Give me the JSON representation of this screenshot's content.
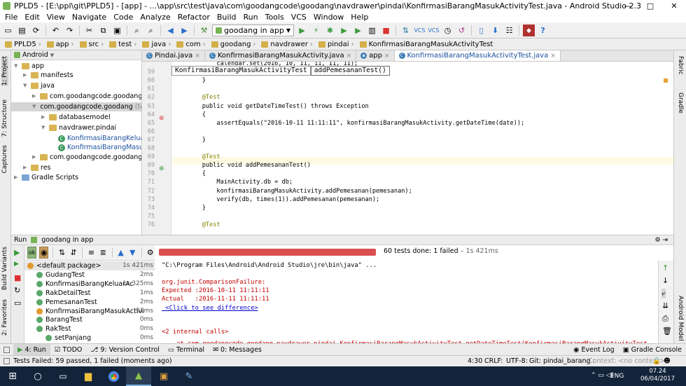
{
  "window": {
    "title": "PPLD5 - [E:\\ppl\\git\\PPLD5] - [app] - ...\\app\\src\\test\\java\\com\\goodangcode\\goodang\\navdrawer\\pindai\\KonfirmasiBarangMasukActivityTest.java - Android Studio 2.3"
  },
  "menu": [
    "File",
    "Edit",
    "View",
    "Navigate",
    "Code",
    "Analyze",
    "Refactor",
    "Build",
    "Run",
    "Tools",
    "VCS",
    "Window",
    "Help"
  ],
  "toolbar": {
    "run_config": "goodang in app"
  },
  "breadcrumbs": [
    "PPLD5",
    "app",
    "src",
    "test",
    "java",
    "com",
    "goodang",
    "navdrawer",
    "pindai",
    "KonfirmasiBarangMasukActivityTest"
  ],
  "project": {
    "view_mode": "Android",
    "tree": [
      {
        "label": "app",
        "indent": 0,
        "kind": "folder"
      },
      {
        "label": "manifests",
        "indent": 1,
        "kind": "folder"
      },
      {
        "label": "java",
        "indent": 1,
        "kind": "folder"
      },
      {
        "label": "com.goodangcode.goodang",
        "indent": 2,
        "kind": "package"
      },
      {
        "label": "com.goodangcode.goodang",
        "suffix": "(test)",
        "indent": 2,
        "kind": "package",
        "selected": true
      },
      {
        "label": "databasemodel",
        "indent": 3,
        "kind": "folder"
      },
      {
        "label": "navdrawer.pindai",
        "indent": 3,
        "kind": "folder"
      },
      {
        "label": "KonfirmasiBarangKeluar",
        "indent": 4,
        "kind": "class"
      },
      {
        "label": "KonfirmasiBarangMasuk",
        "indent": 4,
        "kind": "class"
      },
      {
        "label": "com.goodangcode.goodang.datab",
        "indent": 2,
        "kind": "package"
      },
      {
        "label": "res",
        "indent": 1,
        "kind": "folder"
      },
      {
        "label": "Gradle Scripts",
        "indent": 0,
        "kind": "gradle"
      }
    ]
  },
  "tabs": [
    {
      "label": "Pindai.java",
      "active": false
    },
    {
      "label": "KonfirmasiBarangMasukActivity.java",
      "active": false
    },
    {
      "label": "app",
      "active": false
    },
    {
      "label": "KonfirmasiBarangMasukActivityTest.java",
      "active": true
    }
  ],
  "editor": {
    "popup": [
      "KonfirmasiBarangMasukActivityTest",
      "addPemesananTest()"
    ],
    "lines": [
      {
        "n": "",
        "text": "        calendar.set(2016, 10, 11, 11, 11, 11);"
      },
      {
        "n": "59",
        "text": "        date = calendar.getTime();"
      },
      {
        "n": "60",
        "text": "    }"
      },
      {
        "n": "61",
        "text": ""
      },
      {
        "n": "62",
        "text": "    @Test"
      },
      {
        "n": "63",
        "text": "    public void getDateTimeTest() throws Exception"
      },
      {
        "n": "64",
        "text": "    {"
      },
      {
        "n": "65",
        "text": "        assertEquals(\"2016-10-11 11:11:11\", konfirmasiBarangMasukActivity.getDateTime(date));"
      },
      {
        "n": "66",
        "text": ""
      },
      {
        "n": "67",
        "text": "    }"
      },
      {
        "n": "68",
        "text": ""
      },
      {
        "n": "69",
        "text": "    @Test"
      },
      {
        "n": "69",
        "text": "    public void addPemesananTest()"
      },
      {
        "n": "70",
        "text": "    {"
      },
      {
        "n": "71",
        "text": "        MainActivity.db = db;"
      },
      {
        "n": "72",
        "text": "        konfirmasiBarangMasukActivity.addPemesanan(pemesanan);"
      },
      {
        "n": "73",
        "text": "        verify(db, times(1)).addPemesanan(pemesanan);"
      },
      {
        "n": "74",
        "text": "    }"
      },
      {
        "n": "75",
        "text": ""
      },
      {
        "n": "76",
        "text": "    @Test"
      }
    ]
  },
  "run": {
    "header_label": "Run",
    "config": "goodang in app",
    "status": "60 tests done: 1 failed",
    "duration": "– 1s 421ms",
    "tests": [
      {
        "name": "<default package>",
        "time": "1s 421ms",
        "status": "fail",
        "indent": 0
      },
      {
        "name": "GudangTest",
        "time": "2ms",
        "status": "ok",
        "indent": 1
      },
      {
        "name": "KonfirmasiBarangKeluarAc",
        "time": "1s 325ms",
        "status": "ok",
        "indent": 1
      },
      {
        "name": "RakDetailTest",
        "time": "1ms",
        "status": "ok",
        "indent": 1
      },
      {
        "name": "PemesananTest",
        "time": "2ms",
        "status": "ok",
        "indent": 1
      },
      {
        "name": "KonfirmasiBarangMasukActivi",
        "time": "91ms",
        "status": "fail",
        "indent": 1
      },
      {
        "name": "BarangTest",
        "time": "0ms",
        "status": "ok",
        "indent": 1
      },
      {
        "name": "RakTest",
        "time": "0ms",
        "status": "ok",
        "indent": 1
      },
      {
        "name": "setPanjang",
        "time": "0ms",
        "status": "ok",
        "indent": 2
      }
    ],
    "console": [
      {
        "text": "\"C:\\Program Files\\Android\\Android Studio\\jre\\bin\\java\" ...",
        "cls": ""
      },
      {
        "text": "",
        "cls": ""
      },
      {
        "text": "org.junit.ComparisonFailure:",
        "cls": "red"
      },
      {
        "text": "Expected :2016-10-11 11:11:11",
        "cls": "red"
      },
      {
        "text": "Actual   :2016-11-11 11:11:11",
        "cls": "red"
      },
      {
        "text": " <Click to see difference>",
        "cls": "link"
      },
      {
        "text": "",
        "cls": ""
      },
      {
        "text": "",
        "cls": ""
      },
      {
        "text": "<2 internal calls>",
        "cls": "red"
      },
      {
        "text": "    at com.goodangcode.goodang.navdrawer.pindai.KonfirmasiBarangMasukActivityTest.getDateTimeTest(KonfirmasiBarangMasukActivityTest",
        "cls": "red"
      }
    ]
  },
  "bottom_tabs": [
    {
      "label": "4: Run",
      "active": true
    },
    {
      "label": "TODO",
      "active": false
    },
    {
      "label": "9: Version Control",
      "active": false
    },
    {
      "label": "Terminal",
      "active": false
    },
    {
      "label": "0: Messages",
      "active": false
    }
  ],
  "bottom_right_tabs": [
    "Event Log",
    "Gradle Console"
  ],
  "statusbar": {
    "message": "Tests Failed: 59 passed, 1 failed (moments ago)",
    "position": "4:30",
    "line_sep": "CRLF:",
    "encoding": "UTF-8:",
    "git": "Git: pindai_barang :",
    "context": "Context: <no context>"
  },
  "side_labels": {
    "left": [
      "1: Project",
      "7: Structure",
      "Captures",
      "Build Variants",
      "2: Favorites"
    ],
    "right": [
      "Fabric",
      "Gradle",
      "Android Model"
    ]
  },
  "taskbar": {
    "lang": "ENG",
    "time": "07.24",
    "date": "06/04/2017"
  },
  "colors": {
    "fail_bar": "#d94f4f",
    "pass": "#59a869",
    "fail": "#e09b2c",
    "active_tab": "#1a4f9c"
  }
}
